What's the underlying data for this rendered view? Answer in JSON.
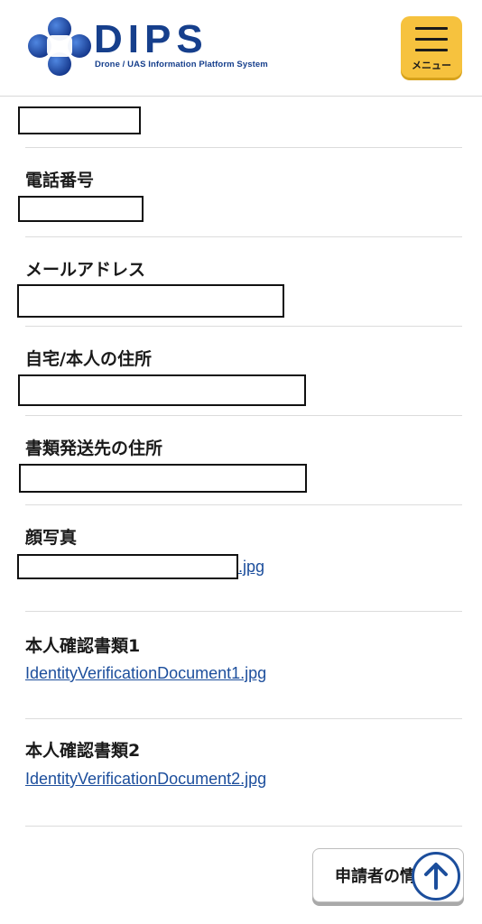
{
  "header": {
    "logo_word": "DIPS",
    "logo_subtitle": "Drone / UAS Information Platform System",
    "menu_label": "メニュー"
  },
  "fields": {
    "phone_label": "電話番号",
    "email_label": "メールアドレス",
    "home_address_label": "自宅/本人の住所",
    "mailing_address_label": "書類発送先の住所",
    "photo_label": "顔写真",
    "photo_file_suffix": ".jpg",
    "id_doc1_label": "本人確認書類1",
    "id_doc1_file": "IdentityVerificationDocument1.jpg",
    "id_doc2_label": "本人確認書類2",
    "id_doc2_file": "IdentityVerificationDocument2.jpg"
  },
  "footer": {
    "applicant_button_label": "申請者の情"
  },
  "colors": {
    "brand_blue": "#163f8c",
    "link_blue": "#1c4e9c",
    "menu_yellow": "#f6c23e"
  },
  "icons": {
    "logo": "dips-logo-icon",
    "menu": "hamburger-icon",
    "scroll_top": "arrow-up-icon"
  }
}
